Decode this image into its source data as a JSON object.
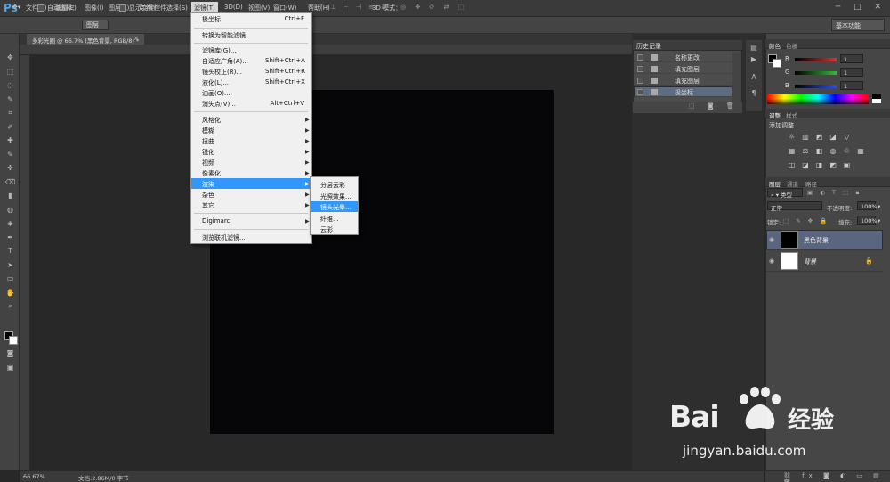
{
  "app": {
    "logo": "Ps",
    "window_controls": "─ □ ✕"
  },
  "menubar": {
    "items": [
      "文件(F)",
      "编辑(E)",
      "图像(I)",
      "图层(L)",
      "文字(Y)",
      "选择(S)",
      "滤镜(T)",
      "3D(D)",
      "视图(V)",
      "窗口(W)",
      "帮助(H)"
    ],
    "active_index": 6
  },
  "options": {
    "auto_select_label": "自动选择：",
    "auto_select_value": "图层",
    "show_transform": "显示变换控件",
    "mode_3d": "3D 模式：",
    "workspace": "基本功能"
  },
  "document": {
    "tab_title": "多彩光圈 @ 66.7% (黑色背景, RGB/8) *",
    "zoom": "66.67%",
    "doc_size": "文档:2.86M/0 字节"
  },
  "filter_menu": {
    "items": [
      {
        "label": "极坐标",
        "shortcut": "Ctrl+F",
        "arrow": false,
        "highlight": false
      },
      {
        "label": "转换为智能滤镜",
        "shortcut": "",
        "arrow": false,
        "highlight": false
      },
      {
        "label": "滤镜库(G)...",
        "shortcut": "",
        "arrow": false,
        "highlight": false
      },
      {
        "label": "自适应广角(A)...",
        "shortcut": "Shift+Ctrl+A",
        "arrow": false,
        "highlight": false
      },
      {
        "label": "镜头校正(R)...",
        "shortcut": "Shift+Ctrl+R",
        "arrow": false,
        "highlight": false
      },
      {
        "label": "液化(L)...",
        "shortcut": "Shift+Ctrl+X",
        "arrow": false,
        "highlight": false
      },
      {
        "label": "油画(O)...",
        "shortcut": "",
        "arrow": false,
        "highlight": false
      },
      {
        "label": "消失点(V)...",
        "shortcut": "Alt+Ctrl+V",
        "arrow": false,
        "highlight": false
      },
      {
        "label": "风格化",
        "shortcut": "",
        "arrow": true,
        "highlight": false
      },
      {
        "label": "模糊",
        "shortcut": "",
        "arrow": true,
        "highlight": false
      },
      {
        "label": "扭曲",
        "shortcut": "",
        "arrow": true,
        "highlight": false
      },
      {
        "label": "锐化",
        "shortcut": "",
        "arrow": true,
        "highlight": false
      },
      {
        "label": "视频",
        "shortcut": "",
        "arrow": true,
        "highlight": false
      },
      {
        "label": "像素化",
        "shortcut": "",
        "arrow": true,
        "highlight": false
      },
      {
        "label": "渲染",
        "shortcut": "",
        "arrow": true,
        "highlight": true
      },
      {
        "label": "杂色",
        "shortcut": "",
        "arrow": true,
        "highlight": false
      },
      {
        "label": "其它",
        "shortcut": "",
        "arrow": true,
        "highlight": false
      },
      {
        "label": "Digimarc",
        "shortcut": "",
        "arrow": true,
        "highlight": false
      },
      {
        "label": "浏览联机滤镜...",
        "shortcut": "",
        "arrow": false,
        "highlight": false
      }
    ]
  },
  "render_submenu": {
    "items": [
      "分层云彩",
      "光照效果...",
      "镜头光晕...",
      "纤维...",
      "云彩"
    ],
    "highlight_index": 2
  },
  "history": {
    "title": "历史记录",
    "rows": [
      "名称更改",
      "填充图层",
      "填充图层",
      "极坐标"
    ],
    "selected_index": 3
  },
  "color_panel": {
    "tabs": [
      "颜色",
      "色板"
    ],
    "channels": [
      {
        "label": "R",
        "value": "1",
        "color": "#e03030"
      },
      {
        "label": "G",
        "value": "1",
        "color": "#30c030"
      },
      {
        "label": "B",
        "value": "1",
        "color": "#3050e0"
      }
    ]
  },
  "adjust_panel": {
    "tabs": [
      "调整",
      "样式"
    ],
    "title": "添加调整"
  },
  "layers_panel": {
    "tabs": [
      "图层",
      "通道",
      "路径"
    ],
    "filter_kind": "类型",
    "blend_mode": "正常",
    "opacity_label": "不透明度:",
    "opacity": "100%",
    "lock_label": "锁定:",
    "fill_label": "填充:",
    "fill": "100%",
    "layers": [
      {
        "name": "黑色背景",
        "thumb": "#000000",
        "selected": true
      },
      {
        "name": "背景",
        "thumb": "#ffffff",
        "selected": false
      }
    ]
  },
  "watermark": {
    "brand": "Bai",
    "cn": "经验",
    "url": "jingyan.baidu.com"
  }
}
